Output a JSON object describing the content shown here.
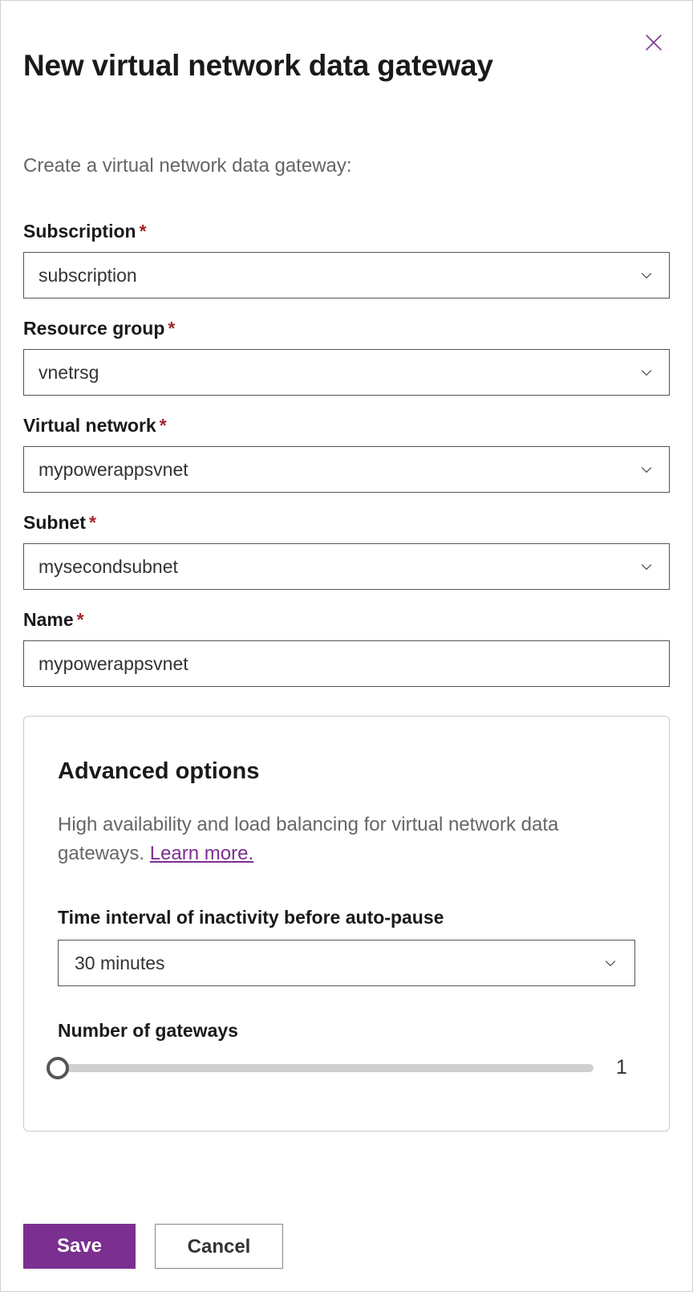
{
  "header": {
    "title": "New virtual network data gateway",
    "subtitle": "Create a virtual network data gateway:"
  },
  "fields": {
    "subscription": {
      "label": "Subscription",
      "value": "subscription",
      "required": true
    },
    "resource_group": {
      "label": "Resource group",
      "value": "vnetrsg",
      "required": true
    },
    "virtual_network": {
      "label": "Virtual network",
      "value": "mypowerappsvnet",
      "required": true
    },
    "subnet": {
      "label": "Subnet",
      "value": "mysecondsubnet",
      "required": true
    },
    "name": {
      "label": "Name",
      "value": "mypowerappsvnet",
      "required": true
    }
  },
  "advanced": {
    "title": "Advanced options",
    "description": "High availability and load balancing for virtual network data gateways. ",
    "learn_more": "Learn more.",
    "time_interval": {
      "label": "Time interval of inactivity before auto-pause",
      "value": "30 minutes"
    },
    "gateways": {
      "label": "Number of gateways",
      "value": "1"
    }
  },
  "footer": {
    "save": "Save",
    "cancel": "Cancel"
  },
  "required_marker": "*"
}
